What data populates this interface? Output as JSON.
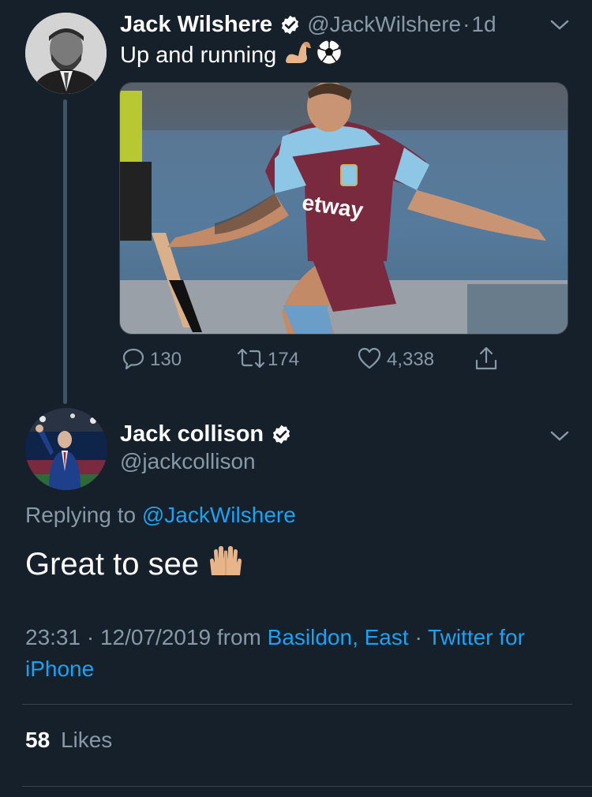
{
  "colors": {
    "background": "#15202b",
    "primary_text": "#ffffff",
    "secondary_text": "#8899a6",
    "link": "#1da1f2",
    "divider": "#38444d",
    "thread_line": "#3d5466"
  },
  "parent_tweet": {
    "display_name": "Jack Wilshere",
    "handle": "@JackWilshere",
    "separator": "·",
    "time": "1d",
    "text": "Up and running",
    "emojis": [
      "flexed-biceps-emoji",
      "soccer-ball-emoji"
    ],
    "avatar_icon": "avatar-photo",
    "media_icon": "football-player-photo",
    "actions": {
      "replies": "130",
      "retweets": "174",
      "likes": "4,338"
    }
  },
  "reply_tweet": {
    "display_name": "Jack collison",
    "handle": "@jackcollison",
    "replying_prefix": "Replying to",
    "replying_to": "@JackWilshere",
    "text": "Great to see",
    "emoji": "raising-hands-emoji",
    "timestamp": "23:31 · 12/07/2019 from",
    "location": "Basildon, East",
    "meta_separator": "·",
    "client": "Twitter for iPhone",
    "likes_count": "58",
    "likes_label": "Likes"
  }
}
